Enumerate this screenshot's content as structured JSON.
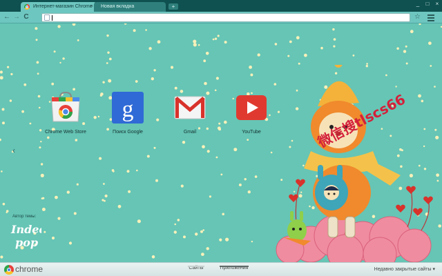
{
  "tabs": [
    {
      "title": "Интернет-магазин Chrome",
      "close": "×"
    },
    {
      "title": "Новая вкладка"
    }
  ],
  "new_tab_label": "+",
  "window_controls": [
    "_",
    "□",
    "×"
  ],
  "nav": {
    "back": "←",
    "forward": "→",
    "reload": "C"
  },
  "omnibox": {
    "value": "",
    "placeholder": ""
  },
  "toolbar_icons": {
    "bookmark": "☆",
    "menu": "menu-icon"
  },
  "apps": [
    {
      "label": "Chrome Web Store",
      "icon": "chrome-web-store-icon"
    },
    {
      "label": "Поиск Google",
      "icon": "google-search-icon"
    },
    {
      "label": "Gmail",
      "icon": "gmail-icon"
    },
    {
      "label": "YouTube",
      "icon": "youtube-icon"
    }
  ],
  "nav_left": "‹",
  "theme": {
    "author_label": "Автор темы:",
    "logo_text": "Indee pop"
  },
  "watermark": "微信搜tlscs66",
  "bottom_bar": {
    "brand": "chrome",
    "pages": [
      {
        "label": "Сайты",
        "active": false
      },
      {
        "label": "Приложения",
        "active": true
      }
    ],
    "recent_label": "Недавно закрытые сайты ▾"
  },
  "colors": {
    "accent": "#66c5b5",
    "tab_bar": "#0f5150",
    "snow": "#f7f0b9"
  }
}
